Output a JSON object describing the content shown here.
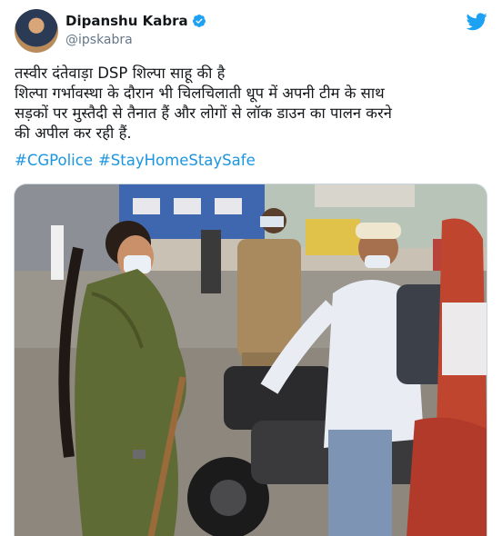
{
  "author": {
    "name": "Dipanshu Kabra",
    "handle": "@ipskabra",
    "verified": true,
    "avatar_icon": "profile-photo",
    "platform_icon": "twitter-bird-icon",
    "accent": "#1da1f2"
  },
  "tweet": {
    "lines": [
      "तस्वीर दंतेवाड़ा DSP शिल्पा साहू की है",
      "शिल्पा गर्भावस्था के दौरान भी चिलचिलाती धूप में अपनी टीम के साथ",
      "सड़कों पर मुस्तैदी से तैनात हैं और लोगों से लॉक डाउन का पालन करने",
      "की अपील कर रही हैं."
    ],
    "hashtags": [
      "#CGPolice",
      "#StayHomeStaySafe"
    ],
    "hashtag_color": "#1b95e0"
  },
  "media": {
    "type": "photo"
  }
}
